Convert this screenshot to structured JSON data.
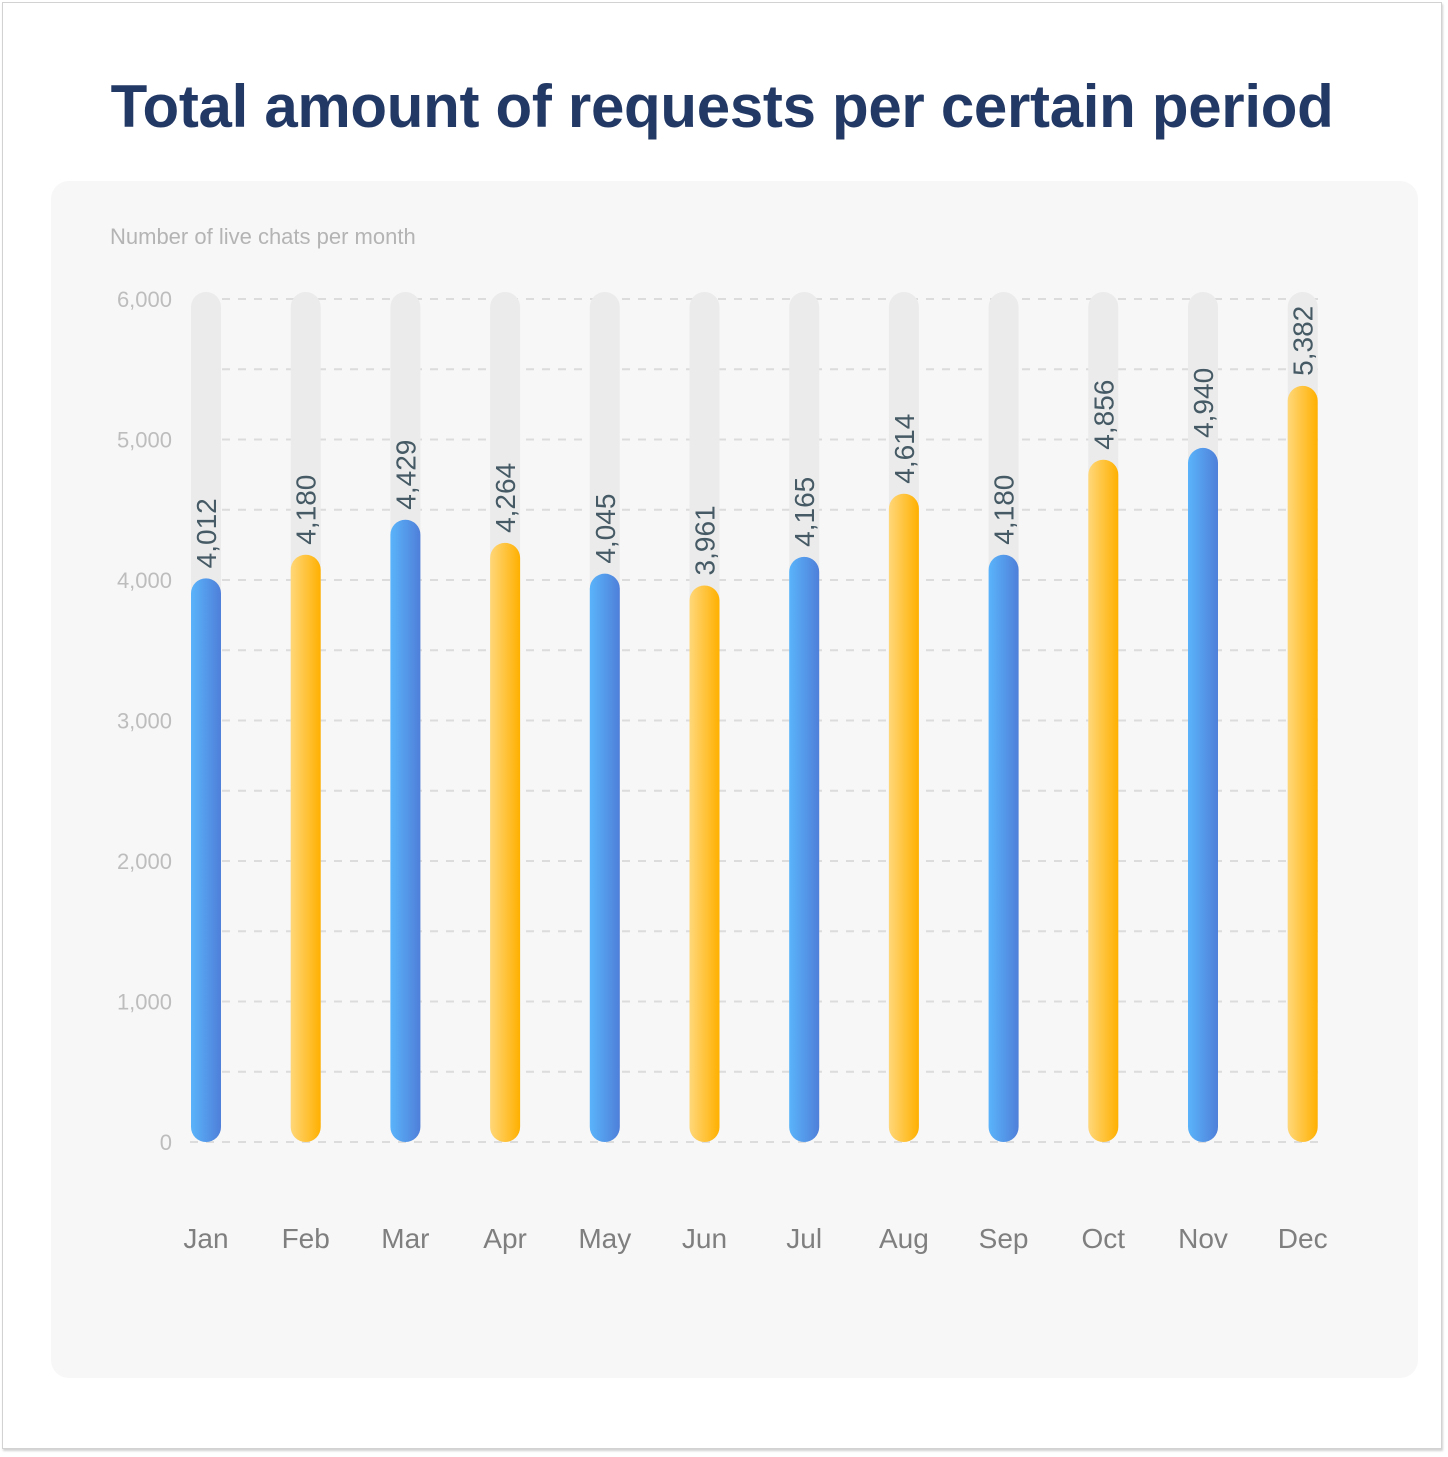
{
  "title": "Total amount of requests per certain period",
  "chart_data": {
    "type": "bar",
    "title": "Total amount of requests per certain period",
    "subtitle": "Number of live chats per month",
    "xlabel": "",
    "ylabel": "Number of live chats per month",
    "categories": [
      "Jan",
      "Feb",
      "Mar",
      "Apr",
      "May",
      "Jun",
      "Jul",
      "Aug",
      "Sep",
      "Oct",
      "Nov",
      "Dec"
    ],
    "values": [
      4012,
      4180,
      4429,
      4264,
      4045,
      3961,
      4165,
      4614,
      4180,
      4856,
      4940,
      5382
    ],
    "data_labels": [
      "4,012",
      "4,180",
      "4,429",
      "4,264",
      "4,045",
      "3,961",
      "4,165",
      "4,614",
      "4,180",
      "4,856",
      "4,940",
      "5,382"
    ],
    "bar_color_series": [
      "blue",
      "yellow",
      "blue",
      "yellow",
      "blue",
      "yellow",
      "blue",
      "yellow",
      "blue",
      "yellow",
      "blue",
      "yellow"
    ],
    "ylim": [
      0,
      6000
    ],
    "yticks": [
      0,
      1000,
      2000,
      3000,
      4000,
      5000,
      6000
    ],
    "ytick_labels": [
      "0",
      "1,000",
      "2,000",
      "3,000",
      "4,000",
      "5,000",
      "6,000"
    ],
    "minor_gridlines": [
      500,
      1500,
      2500,
      3500,
      4500,
      5500
    ],
    "grid": true,
    "grid_style": "dashed",
    "legend": "none",
    "colors": {
      "blue_start": "#5ab4fb",
      "blue_end": "#4f7fd9",
      "yellow_start": "#ffd77a",
      "yellow_end": "#ffb000",
      "track": "#ebebeb",
      "grid": "#dcdcdc",
      "title": "#233965",
      "data_label": "#455a64"
    }
  }
}
